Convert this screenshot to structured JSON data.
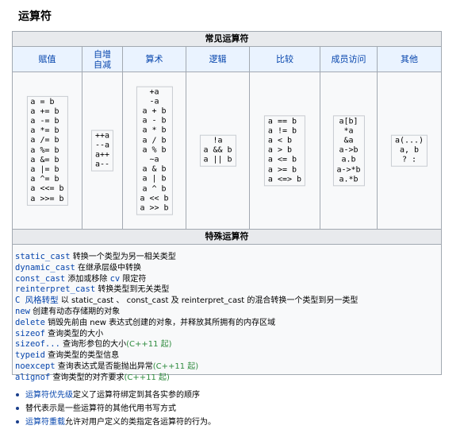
{
  "title": "运算符",
  "table": {
    "header": "常见运算符",
    "columns": [
      {
        "label": "赋值",
        "ops": [
          "a = b",
          "a += b",
          "a -= b",
          "a *= b",
          "a /= b",
          "a %= b",
          "a &= b",
          "a |= b",
          "a ^= b",
          "a <<= b",
          "a >>= b"
        ]
      },
      {
        "label": "自增\n自减",
        "ops": [
          "++a",
          "--a",
          "a++",
          "a--"
        ]
      },
      {
        "label": "算术",
        "ops": [
          "+a",
          "-a",
          "a + b",
          "a - b",
          "a * b",
          "a / b",
          "a % b",
          "~a",
          "a & b",
          "a | b",
          "a ^ b",
          "a << b",
          "a >> b"
        ]
      },
      {
        "label": "逻辑",
        "ops": [
          "!a",
          "a && b",
          "a || b"
        ]
      },
      {
        "label": "比较",
        "ops": [
          "a == b",
          "a != b",
          "a < b",
          "a > b",
          "a <= b",
          "a >= b",
          "a <=> b"
        ]
      },
      {
        "label": "成员访问",
        "ops": [
          "a[b]",
          "*a",
          "&a",
          "a->b",
          "a.b",
          "a->*b",
          "a.*b"
        ]
      },
      {
        "label": "其他",
        "ops": [
          "a(...)",
          "a, b",
          "? :"
        ]
      }
    ],
    "special_header": "特殊运算符",
    "special": [
      {
        "code": "static_cast",
        "text": " 转换一个类型为另一相关类型",
        "extra": ""
      },
      {
        "code": "dynamic_cast",
        "text": " 在继承层级中转换",
        "extra": ""
      },
      {
        "code": "const_cast",
        "text": " 添加或移除 ",
        "code2": "cv",
        "text2": " 限定符"
      },
      {
        "code": "reinterpret_cast",
        "text": " 转换类型到无关类型",
        "extra": ""
      },
      {
        "code": "C 风格转型",
        "text": " 以 static_cast 、 const_cast 及 reinterpret_cast 的混合转换一个类型到另一类型",
        "extra": ""
      },
      {
        "code": "new",
        "text": " 创建有动态存储期的对象",
        "extra": ""
      },
      {
        "code": "delete",
        "text": " 销毁先前由 new 表达式创建的对象，并释放其所拥有的内存区域",
        "extra": ""
      },
      {
        "code": "sizeof",
        "text": " 查询类型的大小",
        "extra": ""
      },
      {
        "code": "sizeof...",
        "text": " 查询形参包的大小",
        "extra": "(C++11 起)"
      },
      {
        "code": "typeid",
        "text": " 查询类型的类型信息",
        "extra": ""
      },
      {
        "code": "noexcept",
        "text": " 查询表达式是否能抛出异常",
        "extra": "(C++11 起)"
      },
      {
        "code": "alignof",
        "text": " 查询类型的对齐要求",
        "extra": "(C++11 起)"
      }
    ]
  },
  "notes": [
    {
      "link": "运算符优先级",
      "text": "定义了运算符绑定到其各实参的顺序"
    },
    {
      "link": "",
      "text": "替代表示是一些运算符的其他代用书写方式"
    },
    {
      "link": "运算符重载",
      "text": "允许对用户定义的类指定各运算符的行为。"
    }
  ]
}
